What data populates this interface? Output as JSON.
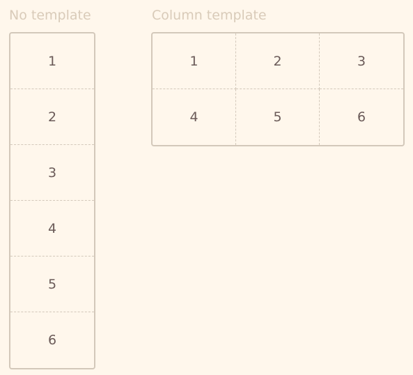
{
  "no_template": {
    "title": "No template",
    "items": [
      "1",
      "2",
      "3",
      "4",
      "5",
      "6"
    ]
  },
  "column_template": {
    "title": "Column template",
    "items": [
      "1",
      "2",
      "3",
      "4",
      "5",
      "6"
    ]
  }
}
